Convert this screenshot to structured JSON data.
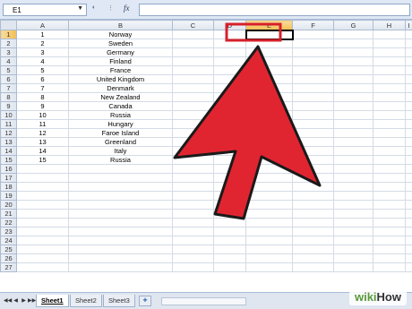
{
  "formula_bar": {
    "name_box": "E1",
    "dropdown_glyph": "▼",
    "fx_label": "fx",
    "formula_value": ""
  },
  "columns": [
    "A",
    "B",
    "C",
    "D",
    "E",
    "F",
    "G",
    "H",
    "I"
  ],
  "selected_column": "E",
  "selected_row": 1,
  "rows": [
    {
      "n": "1",
      "num": "1",
      "country": "Norway"
    },
    {
      "n": "2",
      "num": "2",
      "country": "Sweden"
    },
    {
      "n": "3",
      "num": "3",
      "country": "Germany"
    },
    {
      "n": "4",
      "num": "4",
      "country": "Finland"
    },
    {
      "n": "5",
      "num": "5",
      "country": "France"
    },
    {
      "n": "6",
      "num": "6",
      "country": "United Kingdom"
    },
    {
      "n": "7",
      "num": "7",
      "country": "Denmark"
    },
    {
      "n": "8",
      "num": "8",
      "country": "New Zealand"
    },
    {
      "n": "9",
      "num": "9",
      "country": "Canada"
    },
    {
      "n": "10",
      "num": "10",
      "country": "Russia"
    },
    {
      "n": "11",
      "num": "11",
      "country": "Hungary"
    },
    {
      "n": "12",
      "num": "12",
      "country": "Faroe Island"
    },
    {
      "n": "13",
      "num": "13",
      "country": "Greenland"
    },
    {
      "n": "14",
      "num": "14",
      "country": "Italy"
    },
    {
      "n": "15",
      "num": "15",
      "country": "Russia"
    },
    {
      "n": "16",
      "num": "",
      "country": ""
    },
    {
      "n": "17",
      "num": "",
      "country": ""
    },
    {
      "n": "18",
      "num": "",
      "country": ""
    },
    {
      "n": "19",
      "num": "",
      "country": ""
    },
    {
      "n": "20",
      "num": "",
      "country": ""
    },
    {
      "n": "21",
      "num": "",
      "country": ""
    },
    {
      "n": "22",
      "num": "",
      "country": ""
    },
    {
      "n": "23",
      "num": "",
      "country": ""
    },
    {
      "n": "24",
      "num": "",
      "country": ""
    },
    {
      "n": "25",
      "num": "",
      "country": ""
    },
    {
      "n": "26",
      "num": "",
      "country": ""
    },
    {
      "n": "27",
      "num": "",
      "country": ""
    }
  ],
  "sheet_tabs": [
    {
      "label": "Sheet1",
      "active": true
    },
    {
      "label": "Sheet2",
      "active": false
    },
    {
      "label": "Sheet3",
      "active": false
    }
  ],
  "tab_nav": [
    "◀◀",
    "◀",
    "▶",
    "▶▶"
  ],
  "watermark": {
    "part1": "wiki",
    "part2": "How"
  },
  "colors": {
    "arrow_fill": "#e02531",
    "arrow_stroke": "#1a1a1a",
    "highlight_box": "#d6202c",
    "selection_header": "#f2be56"
  },
  "icons": {
    "arrow": "big-red-pointer-arrow",
    "insert_sheet": "insert-sheet-icon"
  }
}
